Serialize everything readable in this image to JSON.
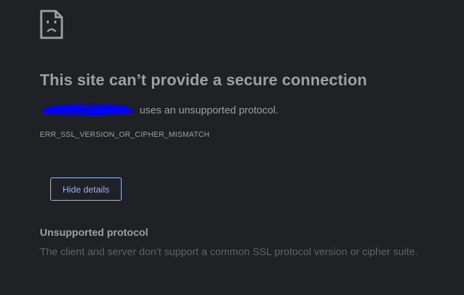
{
  "error": {
    "icon": "sad-page-icon",
    "title": "This site can’t provide a secure connection",
    "summary_suffix": " uses an unsupported protocol.",
    "code": "ERR_SSL_VERSION_OR_CIPHER_MISMATCH",
    "redaction_color": "#0000ff"
  },
  "details_button": {
    "label": "Hide details"
  },
  "details": {
    "heading": "Unsupported protocol",
    "text": "The client and server don’t support a common SSL protocol version or cipher suite."
  },
  "colors": {
    "background": "#202124",
    "text": "#9aa0a6",
    "muted_text": "#5f6368",
    "accent": "#8ab4f8"
  }
}
